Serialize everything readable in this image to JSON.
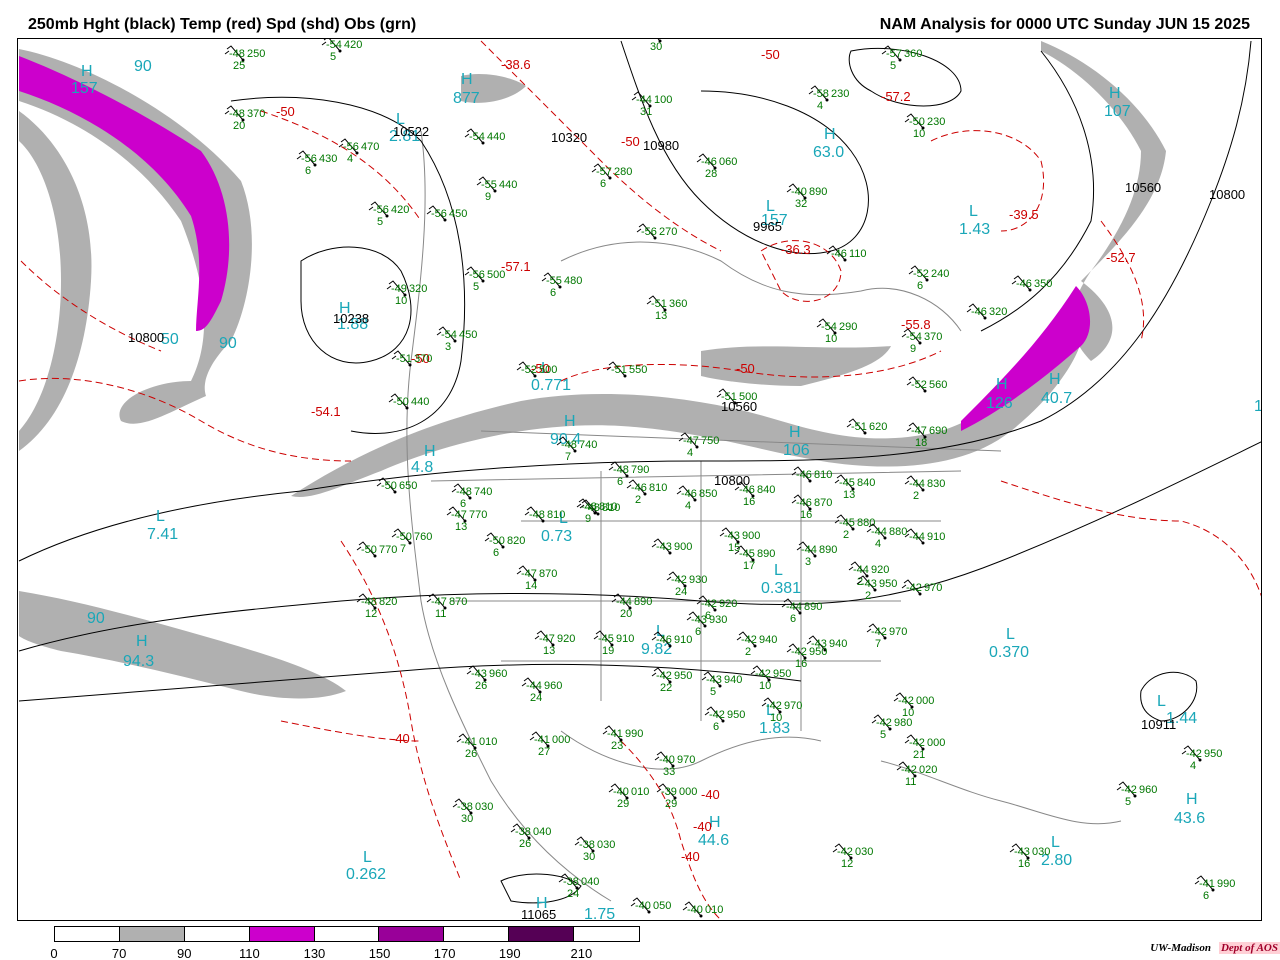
{
  "header": {
    "left_title": "250mb Hght (black) Temp (red) Spd (shd) Obs (grn)",
    "right_title": "NAM Analysis for 0000 UTC Sunday  JUN 15 2025"
  },
  "colors": {
    "height_contour": "#000000",
    "temperature_contour": "#cc0000",
    "observation": "#007700",
    "speed_label": "#1aa7b8",
    "state_boundary": "#888888",
    "shade_70_90": "#b0b0b0",
    "shade_110_130": "#cc00cc",
    "shade_150_170": "#990099",
    "shade_190_210": "#550055"
  },
  "legend": {
    "labels": [
      "0",
      "70",
      "90",
      "110",
      "130",
      "150",
      "170",
      "190",
      "210"
    ],
    "segments": [
      "#ffffff",
      "#b0b0b0",
      "#ffffff",
      "#cc00cc",
      "#ffffff",
      "#990099",
      "#ffffff",
      "#550055",
      "#ffffff"
    ]
  },
  "credit": {
    "org": "UW-Madison",
    "dept": "Dept of AOS"
  },
  "map": {
    "pressure_centers": [
      {
        "mark": "H",
        "value": "157"
      },
      {
        "mark": "H",
        "value": "877"
      },
      {
        "mark": "L",
        "value": "2.81"
      },
      {
        "mark": "H",
        "value": "63.0"
      },
      {
        "mark": "L",
        "value": "157"
      },
      {
        "mark": "H",
        "value": "107"
      },
      {
        "mark": "L",
        "value": "1.43"
      },
      {
        "mark": "H",
        "value": "1.88"
      },
      {
        "mark": "L",
        "value": "0.771"
      },
      {
        "mark": "H",
        "value": "90.4"
      },
      {
        "mark": "H",
        "value": "106"
      },
      {
        "mark": "H",
        "value": "126"
      },
      {
        "mark": "L",
        "value": "7.41"
      },
      {
        "mark": "L",
        "value": "0.73"
      },
      {
        "mark": "L",
        "value": "0.381"
      },
      {
        "mark": "H",
        "value": "94.3"
      },
      {
        "mark": "L",
        "value": "0.370"
      },
      {
        "mark": "L",
        "value": "1.44"
      },
      {
        "mark": "H",
        "value": "43.6"
      },
      {
        "mark": "H",
        "value": "44.6"
      },
      {
        "mark": "L",
        "value": "0.262"
      },
      {
        "mark": "L",
        "value": "2.80"
      },
      {
        "mark": "H",
        "value": "1.75"
      },
      {
        "mark": "L",
        "value": "1.83"
      },
      {
        "mark": "H",
        "value": "4.8"
      },
      {
        "mark": "L",
        "value": "9.82"
      },
      {
        "mark": "H",
        "value": "40.7"
      }
    ],
    "speed_labels": [
      "90",
      "90",
      "90",
      "50",
      "1"
    ],
    "height_labels": [
      "10522",
      "10320",
      "10980",
      "9965",
      "10560",
      "10800",
      "10238",
      "10800",
      "10560",
      "10800",
      "10911",
      "11065"
    ],
    "temp_labels": [
      "-38.6",
      "-50",
      "-50",
      "-57.2",
      "-50",
      "-50",
      "-36.3",
      "-39.5",
      "-52.7",
      "-57.1",
      "-55.8",
      "-54.1",
      "-50",
      "-50",
      "-40",
      "-40",
      "-40",
      "-40"
    ],
    "observations": [
      {
        "t": "-48",
        "h": "250",
        "d": "25"
      },
      {
        "t": "-54",
        "h": "420",
        "d": "5"
      },
      {
        "t": "-45",
        "h": "120",
        "d": "30"
      },
      {
        "t": "-57",
        "h": "360",
        "d": "5"
      },
      {
        "t": "-48",
        "h": "370",
        "d": "20"
      },
      {
        "t": "-56",
        "h": "470",
        "d": "4"
      },
      {
        "t": "-56",
        "h": "430",
        "d": "6"
      },
      {
        "t": "-54",
        "h": "440",
        "d": ""
      },
      {
        "t": "-44",
        "h": "100",
        "d": "31"
      },
      {
        "t": "-58",
        "h": "230",
        "d": "4"
      },
      {
        "t": "-50",
        "h": "230",
        "d": "10"
      },
      {
        "t": "-57",
        "h": "280",
        "d": "6"
      },
      {
        "t": "-46",
        "h": "060",
        "d": "28"
      },
      {
        "t": "-55",
        "h": "440",
        "d": "9"
      },
      {
        "t": "-56",
        "h": "420",
        "d": "5"
      },
      {
        "t": "-56",
        "h": "450",
        "d": ""
      },
      {
        "t": "-56",
        "h": "270",
        "d": ""
      },
      {
        "t": "-40",
        "h": "890",
        "d": "32"
      },
      {
        "t": "-46",
        "h": "110",
        "d": ""
      },
      {
        "t": "-52",
        "h": "240",
        "d": "6"
      },
      {
        "t": "-49",
        "h": "320",
        "d": "10"
      },
      {
        "t": "-56",
        "h": "500",
        "d": "5"
      },
      {
        "t": "-55",
        "h": "480",
        "d": "6"
      },
      {
        "t": "-51",
        "h": "360",
        "d": "13"
      },
      {
        "t": "-46",
        "h": "350",
        "d": ""
      },
      {
        "t": "-46",
        "h": "320",
        "d": ""
      },
      {
        "t": "-54",
        "h": "290",
        "d": "10"
      },
      {
        "t": "-54",
        "h": "370",
        "d": "9"
      },
      {
        "t": "-54",
        "h": "450",
        "d": "3"
      },
      {
        "t": "-51",
        "h": "370",
        "d": ""
      },
      {
        "t": "-52",
        "h": "500",
        "d": ""
      },
      {
        "t": "-51",
        "h": "550",
        "d": ""
      },
      {
        "t": "-51",
        "h": "500",
        "d": ""
      },
      {
        "t": "-50",
        "h": "440",
        "d": ""
      },
      {
        "t": "-52",
        "h": "560",
        "d": ""
      },
      {
        "t": "-51",
        "h": "620",
        "d": ""
      },
      {
        "t": "-47",
        "h": "690",
        "d": "18"
      },
      {
        "t": "-48",
        "h": "740",
        "d": "7"
      },
      {
        "t": "-47",
        "h": "750",
        "d": "4"
      },
      {
        "t": "-50",
        "h": "650",
        "d": ""
      },
      {
        "t": "-48",
        "h": "740",
        "d": "6"
      },
      {
        "t": "-48",
        "h": "790",
        "d": "6"
      },
      {
        "t": "-46",
        "h": "810",
        "d": "2"
      },
      {
        "t": "-46",
        "h": "850",
        "d": "4"
      },
      {
        "t": "-48",
        "h": "810",
        "d": "9"
      },
      {
        "t": "-46",
        "h": "840",
        "d": "16"
      },
      {
        "t": "-46",
        "h": "810",
        "d": ""
      },
      {
        "t": "-45",
        "h": "840",
        "d": "13"
      },
      {
        "t": "-44",
        "h": "830",
        "d": "2"
      },
      {
        "t": "-46",
        "h": "870",
        "d": "16"
      },
      {
        "t": "-45",
        "h": "880",
        "d": "2"
      },
      {
        "t": "-44",
        "h": "880",
        "d": "4"
      },
      {
        "t": "-44",
        "h": "910",
        "d": ""
      },
      {
        "t": "-50",
        "h": "760",
        "d": "7"
      },
      {
        "t": "-47",
        "h": "770",
        "d": "13"
      },
      {
        "t": "-50",
        "h": "820",
        "d": "6"
      },
      {
        "t": "-48",
        "h": "810",
        "d": ""
      },
      {
        "t": "-48",
        "h": "810",
        "d": ""
      },
      {
        "t": "-43",
        "h": "900",
        "d": ""
      },
      {
        "t": "-43",
        "h": "900",
        "d": "15"
      },
      {
        "t": "-45",
        "h": "890",
        "d": "17"
      },
      {
        "t": "-44",
        "h": "890",
        "d": "3"
      },
      {
        "t": "-50",
        "h": "770",
        "d": ""
      },
      {
        "t": "-47",
        "h": "870",
        "d": "14"
      },
      {
        "t": "-44",
        "h": "920",
        "d": "2"
      },
      {
        "t": "-43",
        "h": "950",
        "d": "2"
      },
      {
        "t": "-42",
        "h": "970",
        "d": ""
      },
      {
        "t": "-48",
        "h": "820",
        "d": "12"
      },
      {
        "t": "-47",
        "h": "870",
        "d": "11"
      },
      {
        "t": "-42",
        "h": "930",
        "d": "24"
      },
      {
        "t": "-44",
        "h": "890",
        "d": "20"
      },
      {
        "t": "-42",
        "h": "920",
        "d": "6"
      },
      {
        "t": "-44",
        "h": "890",
        "d": "6"
      },
      {
        "t": "-42",
        "h": "970",
        "d": "7"
      },
      {
        "t": "-46",
        "h": "910",
        "d": ""
      },
      {
        "t": "-47",
        "h": "920",
        "d": "13"
      },
      {
        "t": "-45",
        "h": "910",
        "d": "19"
      },
      {
        "t": "-43",
        "h": "930",
        "d": "6"
      },
      {
        "t": "-42",
        "h": "940",
        "d": "2"
      },
      {
        "t": "-43",
        "h": "940",
        "d": ""
      },
      {
        "t": "-42",
        "h": "950",
        "d": "16"
      },
      {
        "t": "-43",
        "h": "960",
        "d": "26"
      },
      {
        "t": "-44",
        "h": "960",
        "d": "24"
      },
      {
        "t": "-42",
        "h": "950",
        "d": "22"
      },
      {
        "t": "-43",
        "h": "940",
        "d": "5"
      },
      {
        "t": "-42",
        "h": "950",
        "d": "10"
      },
      {
        "t": "-42",
        "h": "970",
        "d": "10"
      },
      {
        "t": "-42",
        "h": "000",
        "d": "10"
      },
      {
        "t": "-42",
        "h": "950",
        "d": "6"
      },
      {
        "t": "-42",
        "h": "980",
        "d": "5"
      },
      {
        "t": "-41",
        "h": "010",
        "d": "26"
      },
      {
        "t": "-41",
        "h": "000",
        "d": "27"
      },
      {
        "t": "-41",
        "h": "990",
        "d": "23"
      },
      {
        "t": "-40",
        "h": "970",
        "d": "33"
      },
      {
        "t": "-42",
        "h": "000",
        "d": "21"
      },
      {
        "t": "-42",
        "h": "020",
        "d": "11"
      },
      {
        "t": "-40",
        "h": "010",
        "d": "29"
      },
      {
        "t": "-39",
        "h": "000",
        "d": "29"
      },
      {
        "t": "-38",
        "h": "030",
        "d": "30"
      },
      {
        "t": "-38",
        "h": "040",
        "d": "26"
      },
      {
        "t": "-38",
        "h": "030",
        "d": "30"
      },
      {
        "t": "-42",
        "h": "030",
        "d": "12"
      },
      {
        "t": "-43",
        "h": "030",
        "d": "16"
      },
      {
        "t": "-42",
        "h": "950",
        "d": "4"
      },
      {
        "t": "-42",
        "h": "960",
        "d": "5"
      },
      {
        "t": "-38",
        "h": "040",
        "d": "24"
      },
      {
        "t": "-40",
        "h": "050",
        "d": ""
      },
      {
        "t": "-40",
        "h": "010",
        "d": ""
      },
      {
        "t": "-41",
        "h": "990",
        "d": "6"
      }
    ]
  }
}
